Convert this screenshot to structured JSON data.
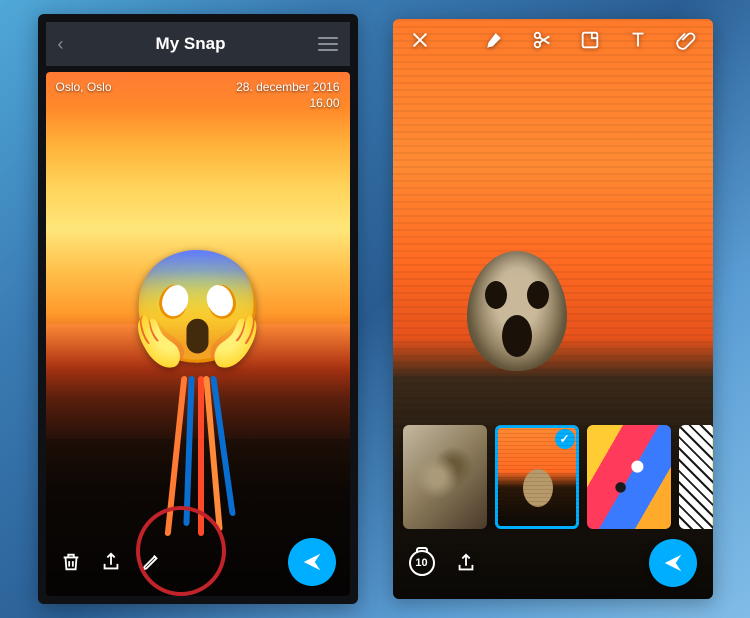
{
  "left": {
    "header_title": "My Snap",
    "meta": {
      "location": "Oslo, Oslo",
      "date": "28. december 2016",
      "time": "16.00"
    },
    "icons": {
      "back": "chevron-left",
      "menu": "hamburger",
      "trash": "trash-icon",
      "share": "share-icon",
      "edit": "pencil-icon",
      "send": "send-icon"
    },
    "overlay": {
      "emoji": "😱"
    }
  },
  "right": {
    "tools": {
      "close": "close-icon",
      "brush": "brush-icon",
      "scissors": "scissors-icon",
      "sticker": "sticker-icon",
      "text": "text-icon",
      "attach": "paperclip-icon"
    },
    "filters": [
      {
        "name": "filter-abstract",
        "selected": false
      },
      {
        "name": "filter-scream",
        "selected": true
      },
      {
        "name": "filter-popart",
        "selected": false
      },
      {
        "name": "filter-comic",
        "selected": false
      }
    ],
    "timer_value": "10",
    "icons": {
      "timer": "timer-icon",
      "share": "share-icon",
      "send": "send-icon"
    }
  }
}
